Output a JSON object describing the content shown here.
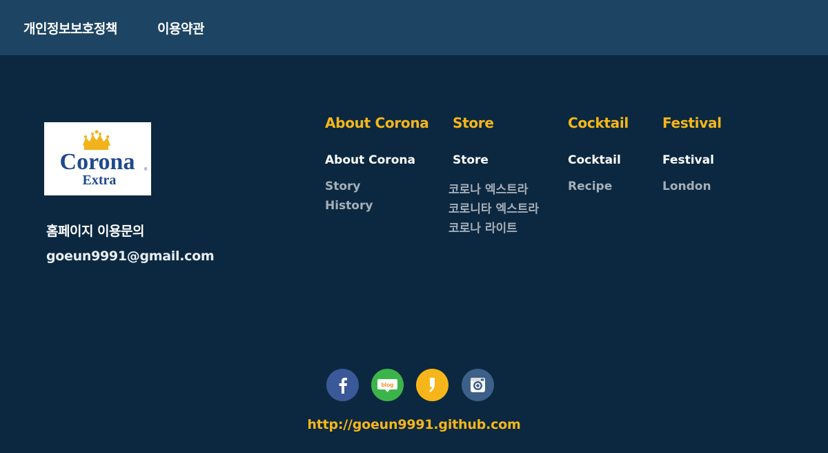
{
  "topnav": {
    "privacy_label": "개인정보보호정책",
    "terms_label": "이용약관"
  },
  "logo": {
    "brand_word": "Corona",
    "brand_sub": "Extra"
  },
  "contact": {
    "title": "홈페이지 이용문의",
    "email": "goeun9991@gmail.com"
  },
  "columns": [
    {
      "title": "About Corona",
      "sub": "About Corona",
      "items": [
        "Story",
        "History"
      ]
    },
    {
      "title": "Store",
      "sub": "Store",
      "items": [
        "코로나 엑스트라",
        "코로니타 엑스트라",
        "코로나 라이트"
      ]
    },
    {
      "title": "Cocktail",
      "sub": "Cocktail",
      "items": [
        "Recipe"
      ]
    },
    {
      "title": "Festival",
      "sub": "Festival",
      "items": [
        "London"
      ]
    }
  ],
  "social": [
    {
      "icon": "facebook-icon",
      "color": "#3b5998"
    },
    {
      "icon": "blog-icon",
      "color": "#3bb54a",
      "text": "blog"
    },
    {
      "icon": "kakaostory-icon",
      "color": "#f6b619"
    },
    {
      "icon": "instagram-icon",
      "color": "#3c6087"
    }
  ],
  "footer": {
    "url": "http://goeun9991.github.com"
  },
  "colors": {
    "background": "#0b2840",
    "topbar": "#1d4463",
    "accent": "#f6b619",
    "muted_text": "#a6afb8"
  }
}
